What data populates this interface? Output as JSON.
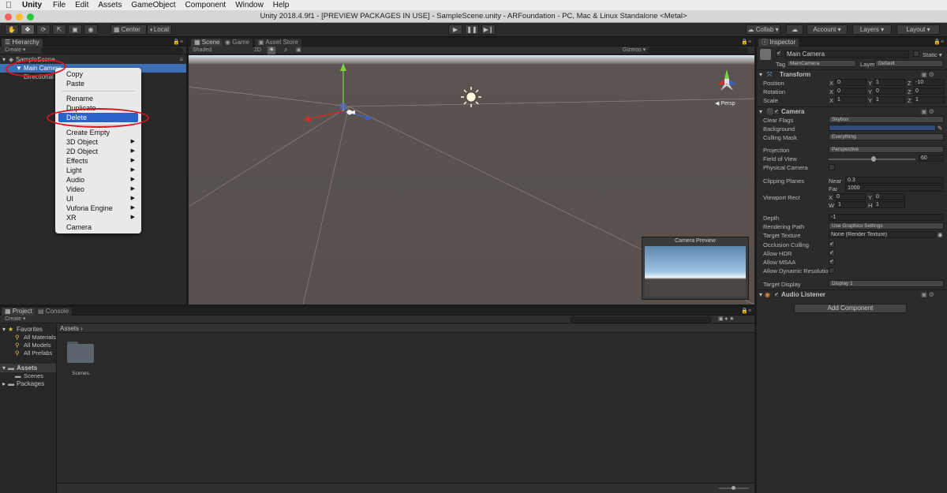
{
  "mac_menu": {
    "app": "Unity",
    "items": [
      "File",
      "Edit",
      "Assets",
      "GameObject",
      "Component",
      "Window",
      "Help"
    ]
  },
  "window": {
    "title": "Unity 2018.4.9f1 - [PREVIEW PACKAGES IN USE] - SampleScene.unity - ARFoundation - PC, Mac & Linux Standalone <Metal>"
  },
  "toolbar": {
    "center": "Center",
    "local": "Local",
    "collab": "Collab",
    "account": "Account",
    "layers": "Layers",
    "layout": "Layout"
  },
  "hierarchy": {
    "tab": "Hierarchy",
    "create": "Create",
    "scene": "SampleScene",
    "items": [
      "Main Camera",
      "Directional Light"
    ]
  },
  "context_menu": {
    "items": [
      "Copy",
      "Paste",
      "Rename",
      "Duplicate",
      "Delete",
      "Create Empty",
      "3D Object",
      "2D Object",
      "Effects",
      "Light",
      "Audio",
      "Video",
      "UI",
      "Vuforia Engine",
      "XR",
      "Camera"
    ],
    "selected": "Delete"
  },
  "scene_view": {
    "tabs": [
      "Scene",
      "Game",
      "Asset Store"
    ],
    "shading": "Shaded",
    "mode_2d": "2D",
    "gizmos": "Gizmos",
    "persp": "Persp",
    "camera_preview": "Camera Preview"
  },
  "project": {
    "tabs": [
      "Project",
      "Console"
    ],
    "create": "Create",
    "favorites": "Favorites",
    "fav_items": [
      "All Materials",
      "All Models",
      "All Prefabs"
    ],
    "assets": "Assets",
    "asset_children": [
      "Scenes"
    ],
    "packages": "Packages",
    "breadcrumb": "Assets",
    "folder_name": "Scenes"
  },
  "inspector": {
    "tab": "Inspector",
    "object_name": "Main Camera",
    "static_label": "Static",
    "tag_label": "Tag",
    "tag_value": "MainCamera",
    "layer_label": "Layer",
    "layer_value": "Default",
    "transform": {
      "title": "Transform",
      "position_label": "Position",
      "rotation_label": "Rotation",
      "scale_label": "Scale",
      "position": {
        "x": "0",
        "y": "1",
        "z": "-10"
      },
      "rotation": {
        "x": "0",
        "y": "0",
        "z": "0"
      },
      "scale": {
        "x": "1",
        "y": "1",
        "z": "1"
      }
    },
    "camera": {
      "title": "Camera",
      "clear_flags": "Clear Flags",
      "clear_flags_value": "Skybox",
      "background": "Background",
      "culling_mask": "Culling Mask",
      "culling_mask_value": "Everything",
      "projection": "Projection",
      "projection_value": "Perspective",
      "fov": "Field of View",
      "fov_value": "60",
      "fov_fraction": 0.52,
      "physical": "Physical Camera",
      "clipping": "Clipping Planes",
      "near_label": "Near",
      "near": "0.3",
      "far_label": "Far",
      "far": "1000",
      "viewport": "Viewport Rect",
      "vx": "0",
      "vy": "0",
      "vw": "1",
      "vh": "1",
      "depth": "Depth",
      "depth_value": "-1",
      "rendering_path": "Rendering Path",
      "rendering_path_value": "Use Graphics Settings",
      "target_texture": "Target Texture",
      "target_texture_value": "None (Render Texture)",
      "occlusion": "Occlusion Culling",
      "hdr": "Allow HDR",
      "msaa": "Allow MSAA",
      "dynres": "Allow Dynamic Resolutio",
      "target_display": "Target Display",
      "target_display_value": "Display 1"
    },
    "audio_listener": "Audio Listener",
    "add_component": "Add Component"
  },
  "colors": {
    "accent": "#3d6fb5",
    "ring": "#d9141e",
    "menu_highlight": "#2a62c9"
  }
}
